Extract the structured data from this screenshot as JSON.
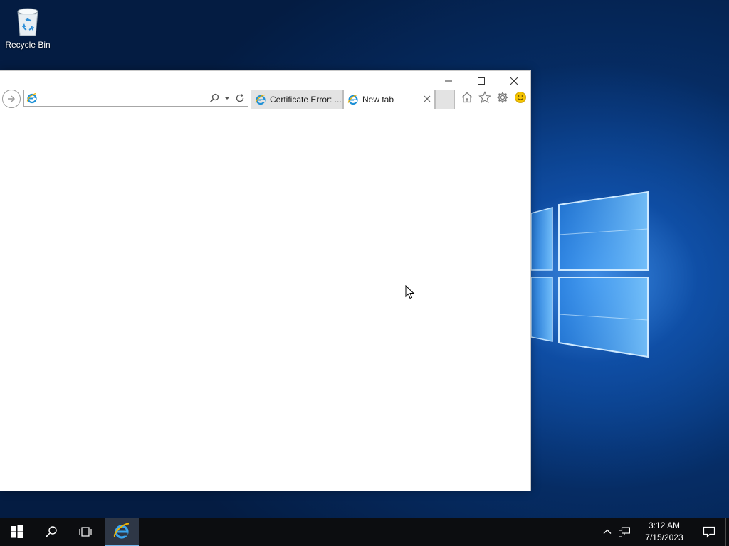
{
  "desktop": {
    "icons": [
      {
        "label": "Recycle Bin",
        "icon": "recycle-bin-icon"
      }
    ]
  },
  "browser": {
    "caption_buttons": [
      "minimize-icon",
      "maximize-icon",
      "close-icon"
    ],
    "address": {
      "value": "",
      "placeholder": ""
    },
    "tabs": [
      {
        "label": "Certificate Error: ...",
        "icon": "ie-icon",
        "active": false
      },
      {
        "label": "New tab",
        "icon": "ie-icon",
        "active": true
      }
    ],
    "command_icons": [
      "home-icon",
      "favorites-star-icon",
      "settings-gear-icon",
      "feedback-smiley-icon"
    ]
  },
  "taskbar": {
    "buttons": [
      "windows-start-icon",
      "search-icon",
      "task-view-icon",
      "internet-explorer-icon"
    ],
    "clock": {
      "time": "3:12 AM",
      "date": "7/15/2023"
    }
  },
  "colors": {
    "taskbar_bg": "#0c0d10",
    "desktop_accent": "#0b4c9c",
    "active_task_underline": "#76b9ed",
    "ie_blue": "#1e90d6",
    "ie_gold": "#f1b400"
  }
}
